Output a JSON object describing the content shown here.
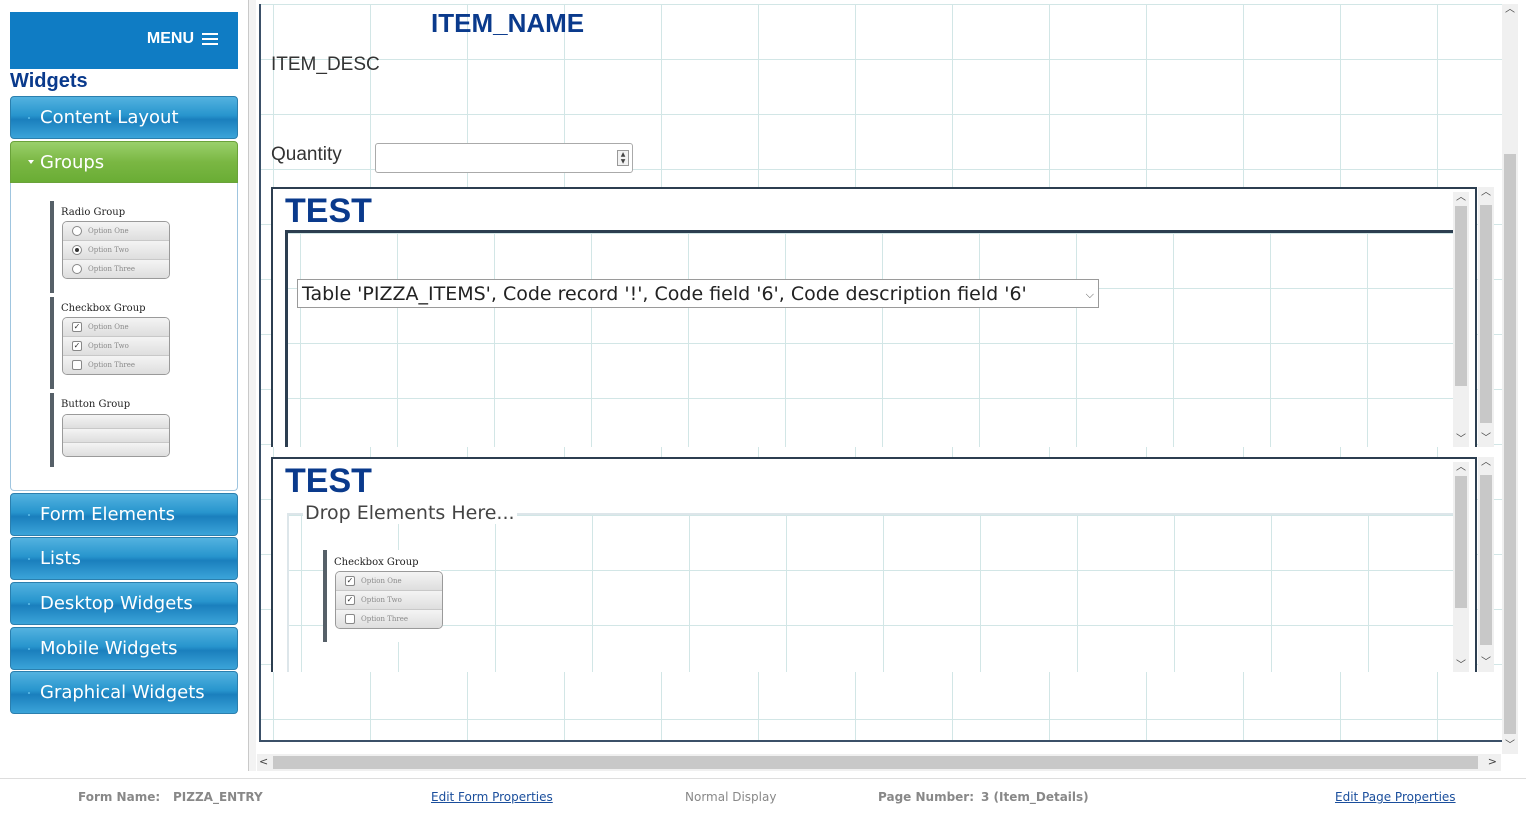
{
  "sidebar": {
    "menu_label": "MENU",
    "widgets_title": "Widgets",
    "sections": [
      {
        "label": "Content Layout"
      },
      {
        "label": "Groups"
      },
      {
        "label": "Form Elements"
      },
      {
        "label": "Lists"
      },
      {
        "label": "Desktop Widgets"
      },
      {
        "label": "Mobile Widgets"
      },
      {
        "label": "Graphical Widgets"
      }
    ],
    "group_widgets": {
      "radio_group": {
        "title": "Radio Group",
        "options": [
          "Option One",
          "Option Two",
          "Option Three"
        ]
      },
      "checkbox_group": {
        "title": "Checkbox Group",
        "options": [
          "Option One",
          "Option Two",
          "Option Three"
        ]
      },
      "button_group": {
        "title": "Button Group"
      }
    }
  },
  "canvas": {
    "item_name": "ITEM_NAME",
    "item_desc": "ITEM_DESC",
    "quantity_label": "Quantity",
    "quantity_value": "",
    "container1": {
      "title": "TEST",
      "select_value": "Table 'PIZZA_ITEMS', Code record '!', Code field '6', Code description field '6'"
    },
    "container2": {
      "title": "TEST",
      "drop_label": "Drop Elements Here...",
      "checkbox_group": {
        "title": "Checkbox Group",
        "options": [
          "Option One",
          "Option Two",
          "Option Three"
        ]
      }
    }
  },
  "footer": {
    "form_name_label": "Form Name:",
    "form_name_value": "PIZZA_ENTRY",
    "edit_form_link": "Edit Form Properties",
    "display_mode": "Normal Display",
    "page_number_label": "Page Number:",
    "page_number_value": "3 (Item_Details)",
    "edit_page_link": "Edit Page Properties"
  },
  "colors": {
    "accent_blue": "#0f7cc4",
    "title_blue": "#0a3a8c",
    "active_green": "#7ab743"
  }
}
